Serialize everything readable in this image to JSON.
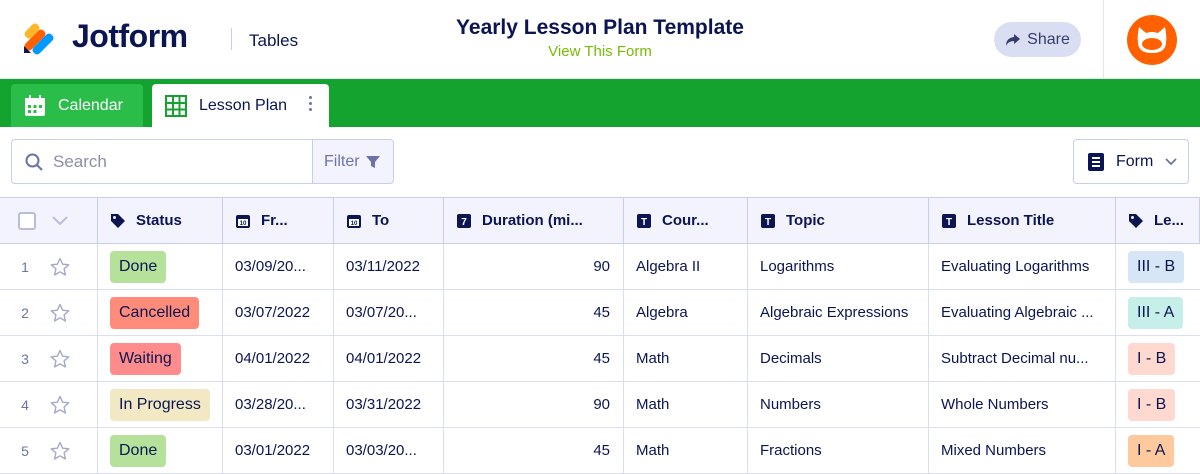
{
  "header": {
    "brand": "Jotform",
    "section": "Tables",
    "title": "Yearly Lesson Plan Template",
    "subtitle_link": "View This Form",
    "share_label": "Share"
  },
  "tabs": [
    {
      "label": "Calendar",
      "icon": "calendar-icon",
      "active": false
    },
    {
      "label": "Lesson Plan",
      "icon": "grid-icon",
      "active": true
    }
  ],
  "toolbar": {
    "search_placeholder": "Search",
    "filter_label": "Filter",
    "form_label": "Form"
  },
  "table": {
    "columns": [
      {
        "label": "Status",
        "icon": "tag-icon"
      },
      {
        "label": "Fr...",
        "icon": "date-icon"
      },
      {
        "label": "To",
        "icon": "date-icon"
      },
      {
        "label": "Duration (mi...",
        "icon": "number-icon"
      },
      {
        "label": "Cour...",
        "icon": "text-icon"
      },
      {
        "label": "Topic",
        "icon": "text-icon"
      },
      {
        "label": "Lesson Title",
        "icon": "text-icon"
      },
      {
        "label": "Le...",
        "icon": "tag-icon"
      }
    ],
    "rows": [
      {
        "num": "1",
        "status": "Done",
        "from": "03/09/20...",
        "to": "03/11/2022",
        "duration": "90",
        "course": "Algebra II",
        "topic": "Logarithms",
        "title": "Evaluating Logarithms",
        "level": "III - B"
      },
      {
        "num": "2",
        "status": "Cancelled",
        "from": "03/07/2022",
        "to": "03/07/20...",
        "duration": "45",
        "course": "Algebra",
        "topic": "Algebraic Expressions",
        "title": "Evaluating Algebraic ...",
        "level": "III - A"
      },
      {
        "num": "3",
        "status": "Waiting",
        "from": "04/01/2022",
        "to": "04/01/2022",
        "duration": "45",
        "course": "Math",
        "topic": "Decimals",
        "title": "Subtract Decimal nu...",
        "level": "I - B"
      },
      {
        "num": "4",
        "status": "In Progress",
        "from": "03/28/20...",
        "to": "03/31/2022",
        "duration": "90",
        "course": "Math",
        "topic": "Numbers",
        "title": "Whole Numbers",
        "level": "I - B"
      },
      {
        "num": "5",
        "status": "Done",
        "from": "03/01/2022",
        "to": "03/03/20...",
        "duration": "45",
        "course": "Math",
        "topic": "Fractions",
        "title": "Mixed Numbers",
        "level": "I - A"
      }
    ]
  },
  "colors": {
    "tabbar": "#13a32e",
    "status_done": "#b6e19b",
    "status_cancelled": "#ff8c7b",
    "status_waiting": "#ff8c8c",
    "status_in_progress": "#f2e8c3",
    "level_iii_b": "#d7e6f6",
    "level_iii_a": "#c6efea",
    "level_i_b": "#ffd9d0",
    "level_i_a": "#ffc99e"
  }
}
